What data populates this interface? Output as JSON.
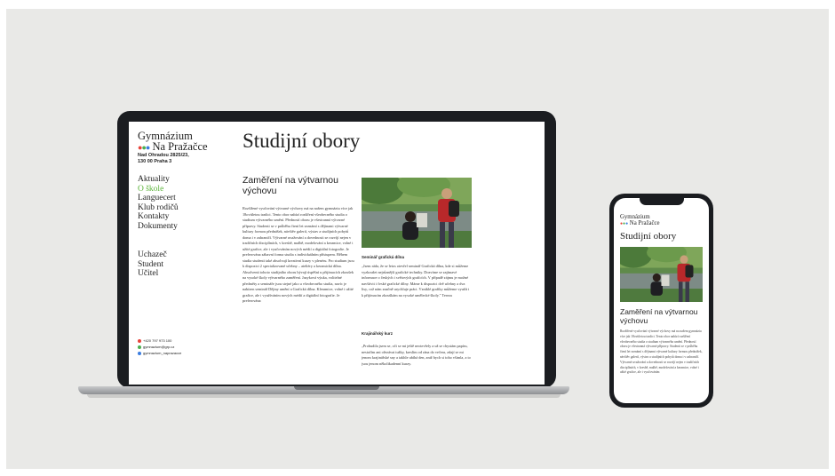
{
  "site": {
    "logo_line1": "Gymnázium",
    "logo_line2": "Na Pražačce",
    "address_line1": "Nad Ohradou 2825/23,",
    "address_line2": "130 00 Praha 3",
    "nav_primary": [
      "Aktuality",
      "O škole",
      "Languecert",
      "Klub rodičů",
      "Kontakty",
      "Dokumenty"
    ],
    "nav_secondary": [
      "Uchazeč",
      "Student",
      "Učitel"
    ],
    "contacts": [
      "+420 797 973 100",
      "gymnazium@grp.cz",
      "gymnazium_naprazacce"
    ],
    "page_title": "Studijní obory",
    "section_title": "Zaměření na výtvarnou výchovu",
    "body_main": "Rozšířené vyučování výtvarné výchovy má na našem gymnáziu více jak 18ovitletou tradici. Tento obor nabízí rozšíření všeobecného studia o studium výtvarného umění. Předností oboru je všestranná výtvarné přípravy. Studenti se v průběhu čtení let seznámí s dějinami výtvarné kultury formou přednášek, návštěv galerií, výstav a studijních pobytů doma i v zahraničí. Výtvarné uvažování a dovednosti se rozvíjí nejen v tradičních disciplínách, v kresbě, malbě, modelování a keramice, volné i užité grafice, ale i vyučováním nových médií a digitální fotografie. Je preferována zábavní forma studia s individuálním přístupem. Během studia studenti také absolvují kreativní kurzy v plenéru. Pro studium jsou k dispozici 2 specializované učebny – ateliéry a keramická dílna. Absolventi tohoto studijního oboru bývají úspěšní u přijímacích zkoušek na vysoké školy výtvarného zaměření. Jazyková výuka, volitelné předměty a semináře jsou stejné jako u všeobecného studia, navíc je nabízen seminář Dějiny umění a Grafická dílna. Kleramice, volné i užité grafice, ale i využíváním nových médií a digitální fotografie. Je preferována",
    "caption1": "Seminář grafická dílna",
    "body_caption1": "„Jsem ráda, že se letos otevřel seminář Grafická dílna, kde si můžeme vyzkoušet nejrůznější grafické techniky. Dozvíme se zajímavé informace o českých i světových grafících. V případě zájmu je možné navštívit i české grafické dílny. Máme k dispozici dvě učebny a dva lisy, což nám značně urychluje práci. Vzniklé grafiky můžeme využít i k přijímacím zkouškám na vysoké umělecké školy.\" Tereza",
    "caption2": "Krajinářský kurz",
    "body_caption2": "„Probudila jsem se, oči se mi ještě neotevřely a už se chystám papíru, nestačím ani ořezávat tužky, kreslím od rána do večera, zdají se mi jenom krajinářské sny a takhle ubíhá den, aniž bych si toho všimla, a to jsou jenom několikadenní kurzy."
  },
  "phone": {
    "logo_line1": "Gymnázium",
    "logo_line2": "Na Pražačce",
    "page_title": "Studijní obory",
    "section_title": "Zaměření na výtvarnou výchovu",
    "body": "Rozšířené vyučování výtvarné výchovy má na našem gymnáziu více jak 18ovitletou tradici. Tento obor nabízí rozšíření všeobecného studia o studium výtvarného umění. Předností oboru je všestranná výtvarné přípravy. Studenti se v průběhu čtení let seznámí s dějinami výtvarné kultury formou přednášek, návštěv galerií, výstav a studijních pobytů doma i v zahraničí. Výtvarné uvažování a dovednosti se rozvíjí nejen v tradičních disciplínách, v kresbě, malbě, modelování a keramice, volné i užité grafice, ale i vyučováním"
  },
  "colors": {
    "accent_green": "#5bb33a",
    "dot_red": "#e8433a",
    "dot_green": "#4caf50",
    "dot_blue": "#3b7de0",
    "background": "#e9e9e7",
    "device_frame": "#1b1d21"
  },
  "icons": [
    "phone-icon",
    "email-icon",
    "instagram-icon"
  ]
}
